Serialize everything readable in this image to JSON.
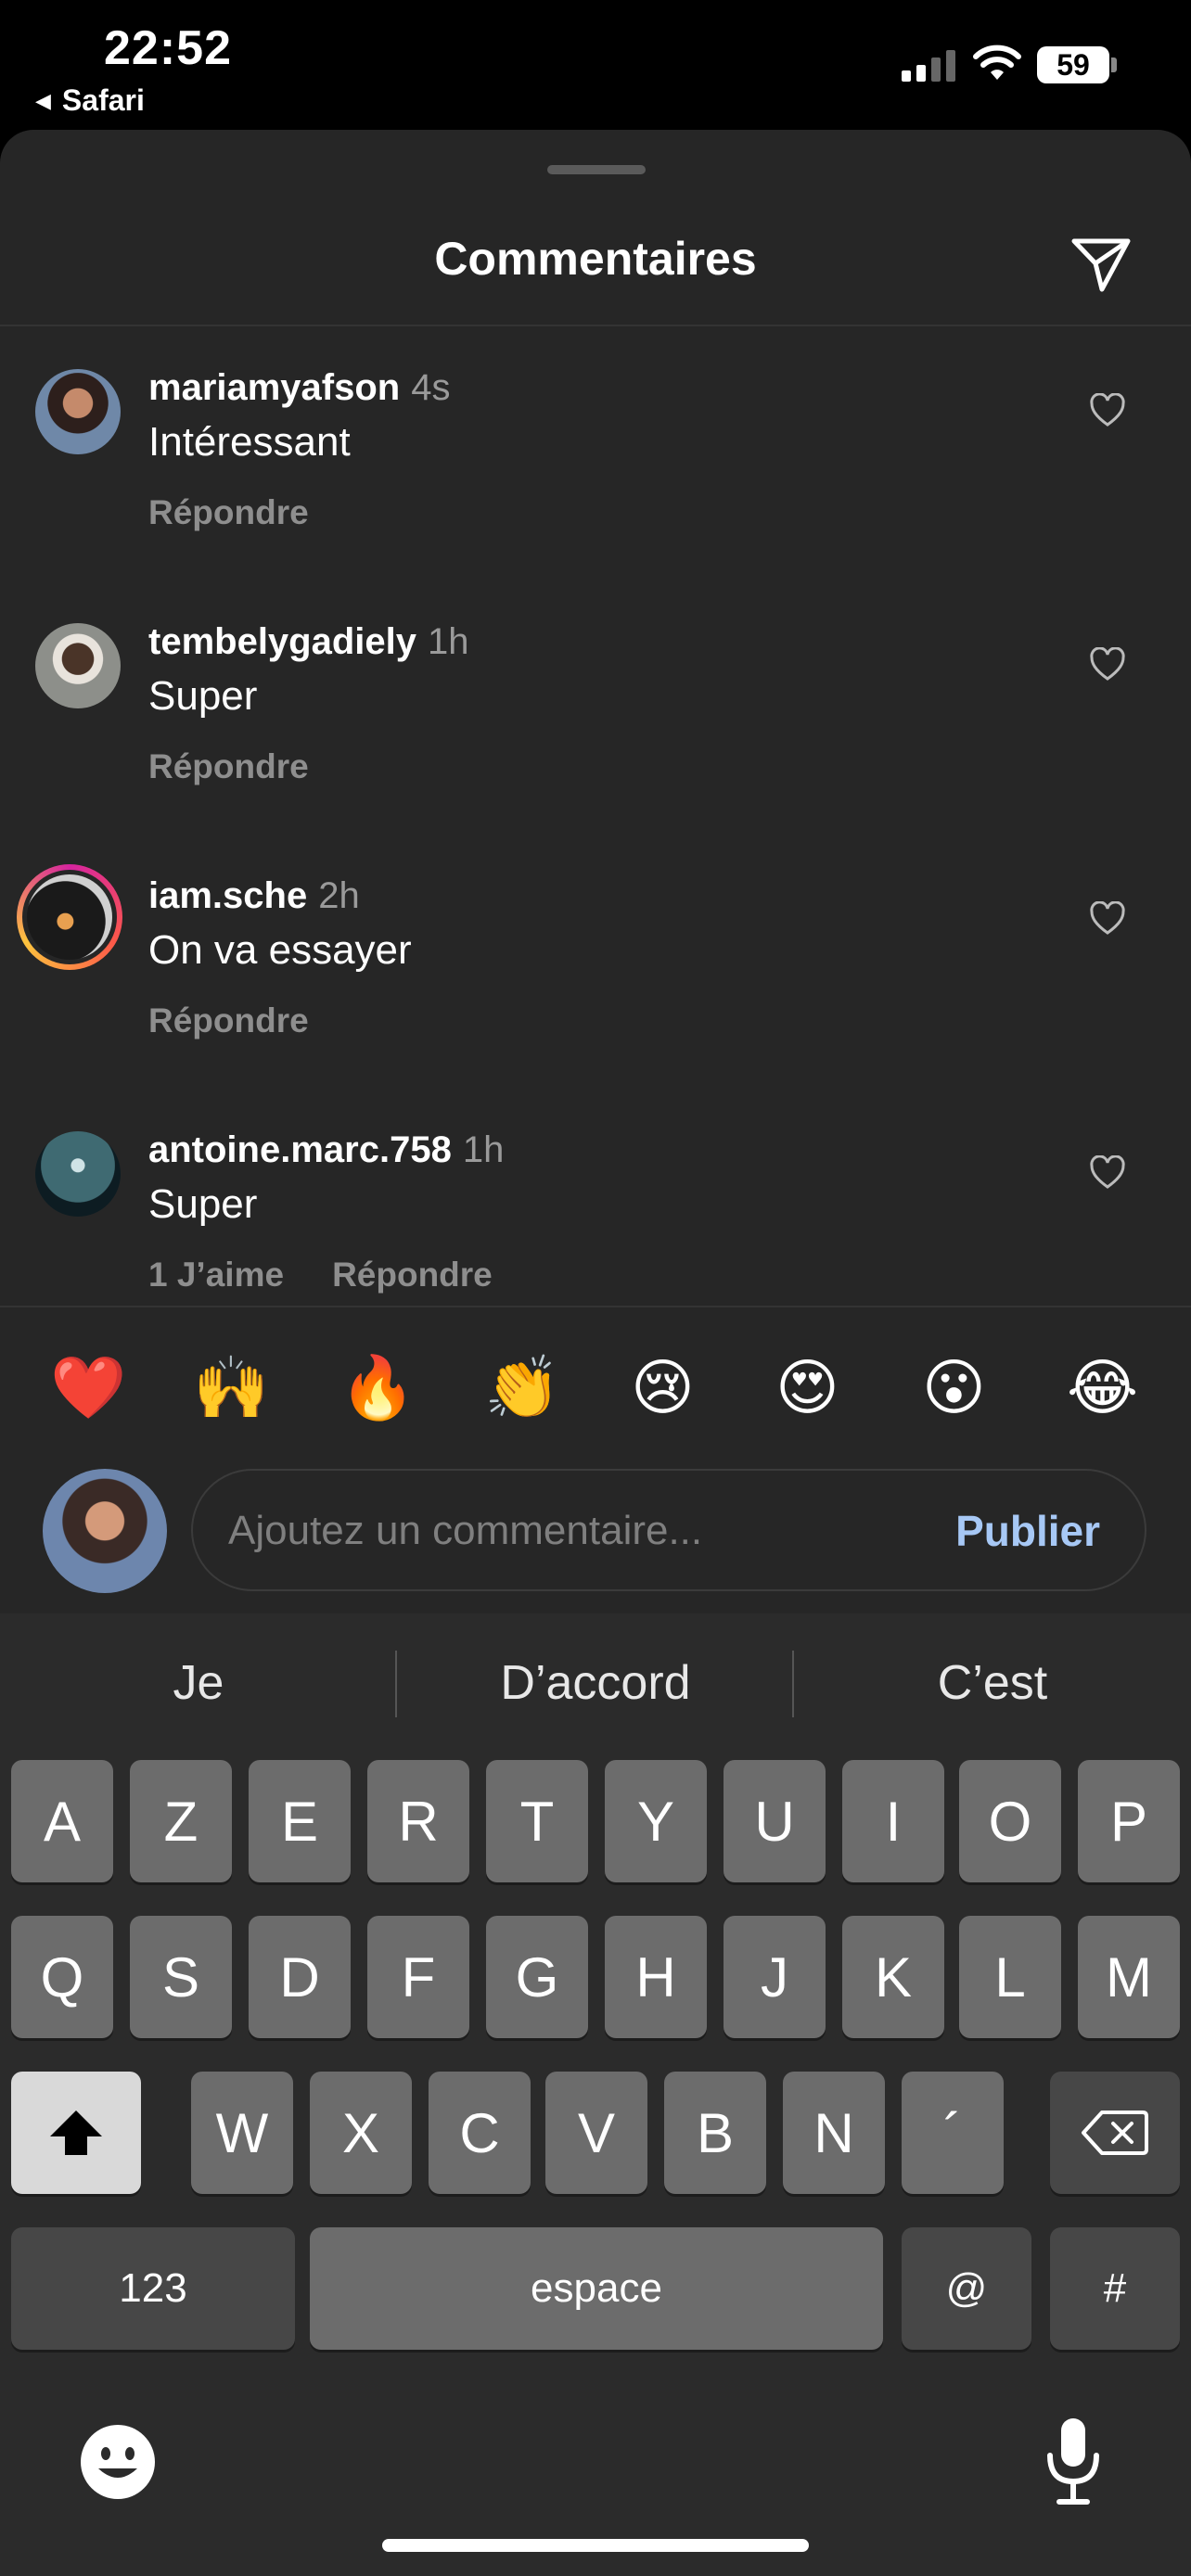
{
  "status_bar": {
    "time": "22:52",
    "back_app": "Safari",
    "battery": "59"
  },
  "sheet": {
    "title": "Commentaires",
    "send_icon": "paper-plane-icon"
  },
  "comments": [
    {
      "username": "mariamyafson",
      "ago": "4s",
      "text": "Intéressant",
      "likes": "",
      "reply": "Répondre"
    },
    {
      "username": "tembelygadiely",
      "ago": "1h",
      "text": "Super",
      "likes": "",
      "reply": "Répondre"
    },
    {
      "username": "iam.sche",
      "ago": "2h",
      "text": "On va essayer",
      "likes": "",
      "reply": "Répondre"
    },
    {
      "username": "antoine.marc.758",
      "ago": "1h",
      "text": "Super",
      "likes": "1 J’aime",
      "reply": "Répondre"
    }
  ],
  "reactions": [
    "❤️",
    "🙌",
    "🔥",
    "👏",
    "😢",
    "😍",
    "😮",
    "😂"
  ],
  "composer": {
    "placeholder": "Ajoutez un commentaire...",
    "publish": "Publier"
  },
  "keyboard": {
    "suggestions": [
      "Je",
      "D’accord",
      "C’est"
    ],
    "row1": [
      "A",
      "Z",
      "E",
      "R",
      "T",
      "Y",
      "U",
      "I",
      "O",
      "P"
    ],
    "row2": [
      "Q",
      "S",
      "D",
      "F",
      "G",
      "H",
      "J",
      "K",
      "L",
      "M"
    ],
    "row3": [
      "W",
      "X",
      "C",
      "V",
      "B",
      "N",
      "´"
    ],
    "numbers": "123",
    "space": "espace",
    "at": "@",
    "hash": "#"
  }
}
